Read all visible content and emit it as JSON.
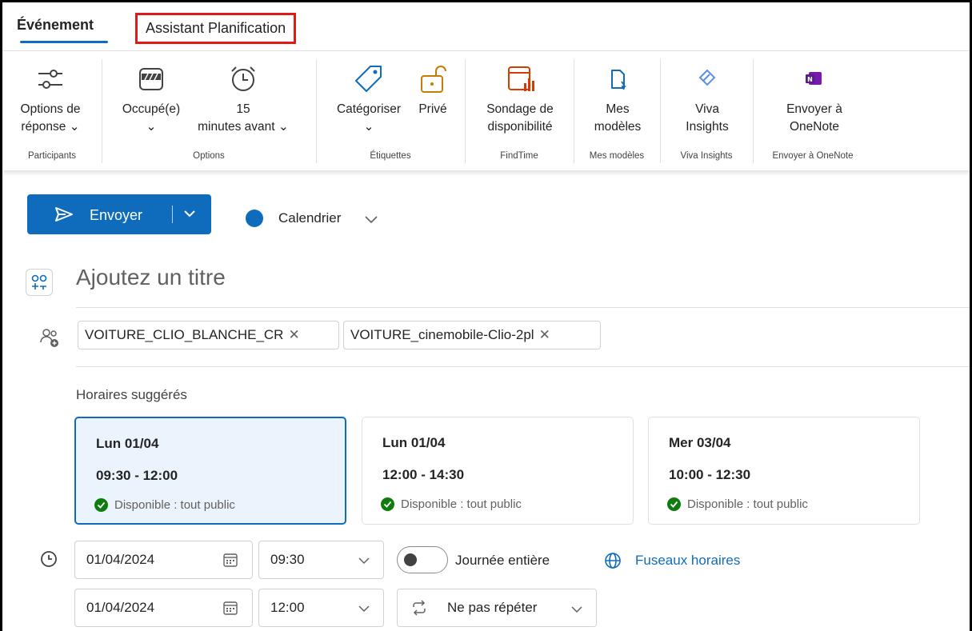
{
  "tabs": {
    "event": "Événement",
    "assistant": "Assistant Planification"
  },
  "ribbon": {
    "response_options": {
      "line1": "Options de",
      "line2": "réponse ⌄"
    },
    "busy": {
      "line1": "Occupé(e)",
      "line2": "⌄"
    },
    "reminder": {
      "line1": "15",
      "line2": "minutes avant ⌄"
    },
    "categorize": {
      "line1": "Catégoriser",
      "line2": "⌄"
    },
    "private": {
      "line1": "Privé"
    },
    "poll": {
      "line1": "Sondage de",
      "line2": "disponibilité"
    },
    "templates": {
      "line1": "Mes",
      "line2": "modèles"
    },
    "viva": {
      "line1": "Viva",
      "line2": "Insights"
    },
    "onenote": {
      "line1": "Envoyer à",
      "line2": "OneNote"
    },
    "groups": {
      "participants": "Participants",
      "options": "Options",
      "tags": "Étiquettes",
      "findtime": "FindTime",
      "templates": "Mes modèles",
      "viva": "Viva Insights",
      "onenote": "Envoyer à OneNote"
    }
  },
  "send": {
    "label": "Envoyer"
  },
  "calendar": {
    "label": "Calendrier"
  },
  "title": {
    "placeholder": "Ajoutez un titre"
  },
  "attendees": [
    {
      "name": "VOITURE_CLIO_BLANCHE_CR",
      "remove": "✕"
    },
    {
      "name": "VOITURE_cinemobile-Clio-2pl",
      "remove": "✕"
    }
  ],
  "suggestions": {
    "title": "Horaires suggérés",
    "items": [
      {
        "day": "Lun 01/04",
        "time": "09:30 - 12:00",
        "status": "Disponible : tout public"
      },
      {
        "day": "Lun 01/04",
        "time": "12:00 - 14:30",
        "status": "Disponible : tout public"
      },
      {
        "day": "Mer 03/04",
        "time": "10:00 - 12:30",
        "status": "Disponible : tout public"
      }
    ]
  },
  "schedule": {
    "start_date": "01/04/2024",
    "start_time": "09:30",
    "end_date": "01/04/2024",
    "end_time": "12:00",
    "all_day": "Journée entière",
    "timezones": "Fuseaux horaires",
    "repeat": "Ne pas répéter"
  },
  "colors": {
    "accent": "#0f6cbd",
    "available": "#107c10",
    "highlight": "#e01919"
  }
}
